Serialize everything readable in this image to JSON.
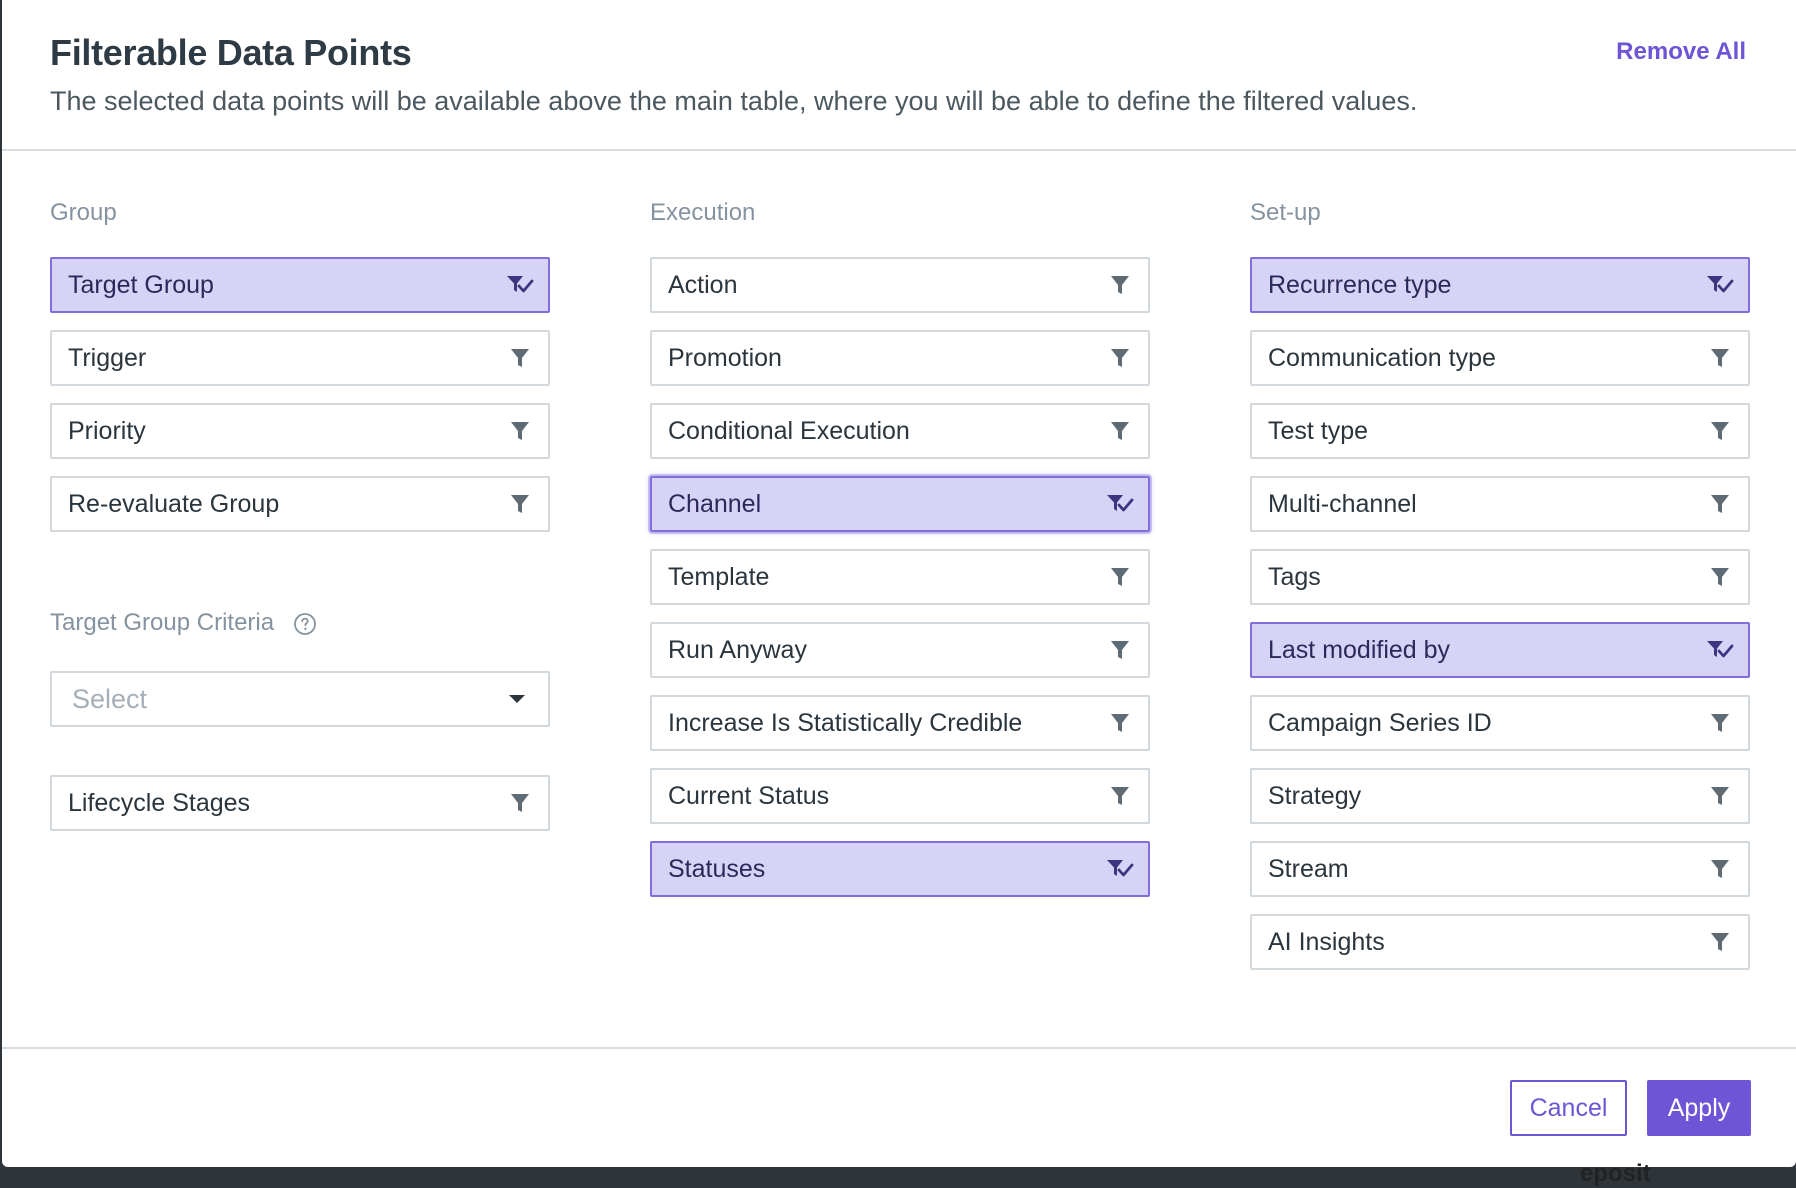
{
  "header": {
    "title": "Filterable Data Points",
    "subtitle": "The selected data points will be available above the main table, where you will be able to define the filtered values.",
    "remove_all_label": "Remove All"
  },
  "group": {
    "title": "Group",
    "items": [
      {
        "label": "Target Group",
        "selected": true
      },
      {
        "label": "Trigger",
        "selected": false
      },
      {
        "label": "Priority",
        "selected": false
      },
      {
        "label": "Re-evaluate Group",
        "selected": false
      }
    ],
    "criteria_title": "Target Group Criteria",
    "criteria_select_placeholder": "Select",
    "lifecycle_label": "Lifecycle Stages"
  },
  "execution": {
    "title": "Execution",
    "items": [
      {
        "label": "Action",
        "selected": false
      },
      {
        "label": "Promotion",
        "selected": false
      },
      {
        "label": "Conditional Execution",
        "selected": false
      },
      {
        "label": "Channel",
        "selected": true,
        "focused": true
      },
      {
        "label": "Template",
        "selected": false
      },
      {
        "label": "Run Anyway",
        "selected": false
      },
      {
        "label": "Increase Is Statistically Credible",
        "selected": false
      },
      {
        "label": "Current Status",
        "selected": false
      },
      {
        "label": "Statuses",
        "selected": true
      }
    ]
  },
  "setup": {
    "title": "Set-up",
    "items": [
      {
        "label": "Recurrence type",
        "selected": true
      },
      {
        "label": "Communication type",
        "selected": false
      },
      {
        "label": "Test type",
        "selected": false
      },
      {
        "label": "Multi-channel",
        "selected": false
      },
      {
        "label": "Tags",
        "selected": false
      },
      {
        "label": "Last modified by",
        "selected": true
      },
      {
        "label": "Campaign Series ID",
        "selected": false
      },
      {
        "label": "Strategy",
        "selected": false
      },
      {
        "label": "Stream",
        "selected": false
      },
      {
        "label": "AI Insights",
        "selected": false
      }
    ]
  },
  "footer": {
    "cancel_label": "Cancel",
    "apply_label": "Apply"
  },
  "backdrop": {
    "partial_text": "eposit"
  },
  "icons": {
    "filter": "filter-icon",
    "filter_selected": "filter-check-icon",
    "help": "help-circle-icon",
    "caret": "caret-down-icon"
  },
  "colors": {
    "accent": "#6d55d6",
    "selected_bg": "#d6d3f6",
    "selected_border": "#7f6fdc",
    "icon_gray": "#5f6b74",
    "icon_selected": "#3d3580"
  }
}
